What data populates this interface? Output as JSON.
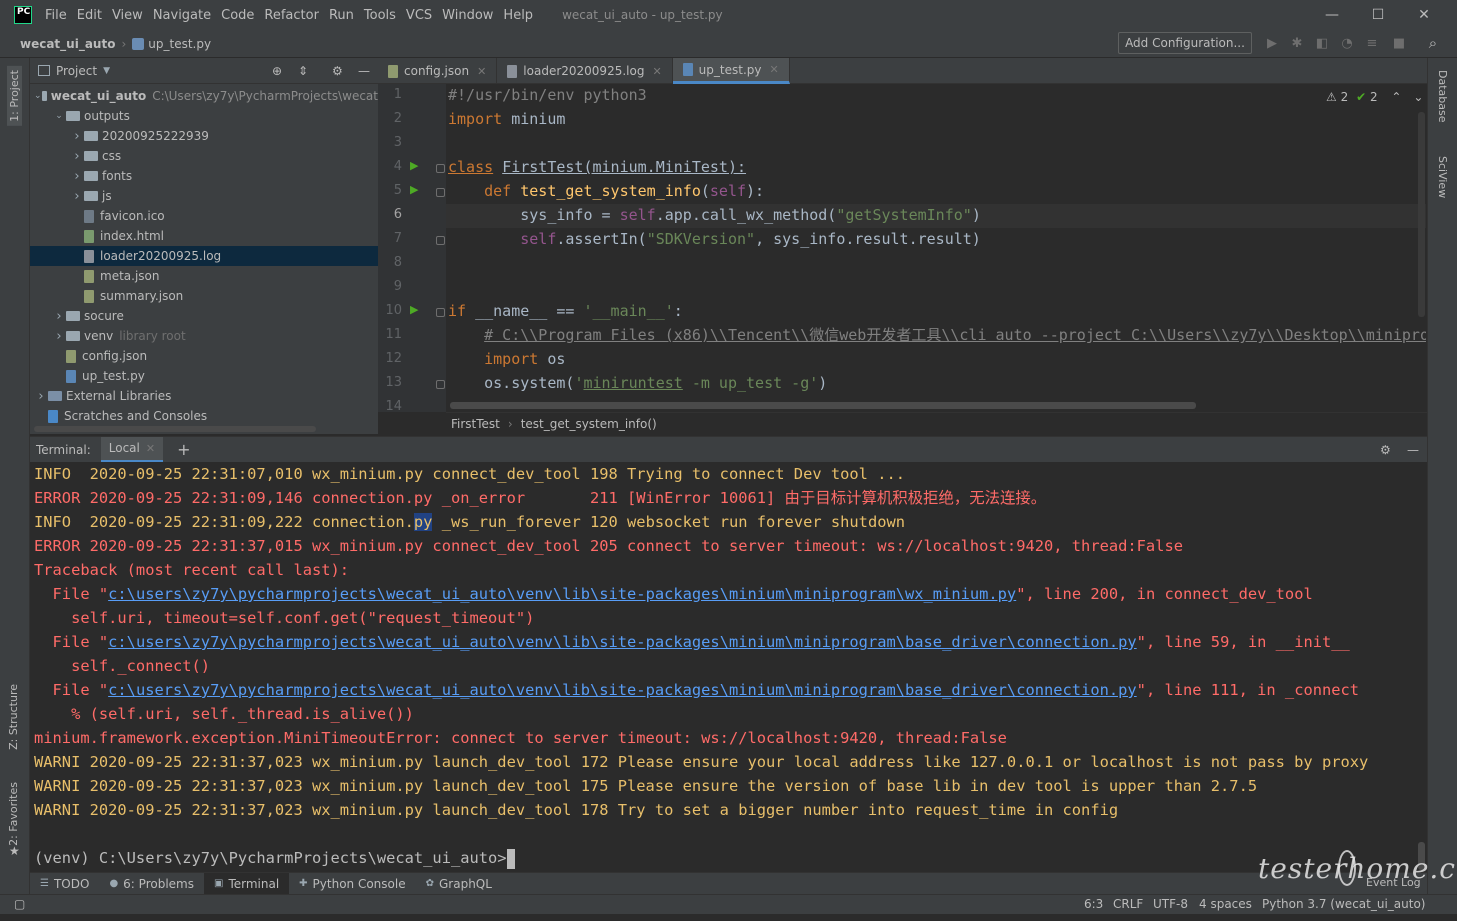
{
  "app": {
    "logo": "PC",
    "menu": [
      "File",
      "Edit",
      "View",
      "Navigate",
      "Code",
      "Refactor",
      "Run",
      "Tools",
      "VCS",
      "Window",
      "Help"
    ],
    "window_title": "wecat_ui_auto - up_test.py",
    "controls": {
      "minimize": "—",
      "maximize": "☐",
      "close": "✕"
    }
  },
  "navbar": {
    "project": "wecat_ui_auto",
    "file": "up_test.py",
    "add_configuration": "Add Configuration..."
  },
  "left_strip": {
    "project_tab": "1: Project",
    "structure_tab": "Z: Structure",
    "favorites_tab": "2: Favorites"
  },
  "right_strip": {
    "database_tab": "Database",
    "sciview_tab": "SciView"
  },
  "project_panel": {
    "title": "Project",
    "items": [
      {
        "name": "wecat_ui_auto",
        "path": "C:\\Users\\zy7y\\PycharmProjects\\wecat",
        "kind": "folder",
        "indent": 0,
        "expanded": true
      },
      {
        "name": "outputs",
        "kind": "folder",
        "indent": 1,
        "expanded": true
      },
      {
        "name": "20200925222939",
        "kind": "folder",
        "indent": 2,
        "expanded": false
      },
      {
        "name": "css",
        "kind": "folder",
        "indent": 2,
        "expanded": false
      },
      {
        "name": "fonts",
        "kind": "folder",
        "indent": 2,
        "expanded": false
      },
      {
        "name": "js",
        "kind": "folder",
        "indent": 2,
        "expanded": false
      },
      {
        "name": "favicon.ico",
        "kind": "file",
        "indent": 2
      },
      {
        "name": "index.html",
        "kind": "html",
        "indent": 2
      },
      {
        "name": "loader20200925.log",
        "kind": "log",
        "indent": 2,
        "selected": true
      },
      {
        "name": "meta.json",
        "kind": "json",
        "indent": 2
      },
      {
        "name": "summary.json",
        "kind": "json",
        "indent": 2
      },
      {
        "name": "socure",
        "kind": "folder",
        "indent": 1,
        "expanded": false
      },
      {
        "name": "venv",
        "note": "library root",
        "kind": "folder",
        "indent": 1,
        "expanded": false
      },
      {
        "name": "config.json",
        "kind": "json",
        "indent": 1
      },
      {
        "name": "up_test.py",
        "kind": "py",
        "indent": 1
      },
      {
        "name": "External Libraries",
        "kind": "lib",
        "indent": 0,
        "expanded": false
      },
      {
        "name": "Scratches and Consoles",
        "kind": "scratch",
        "indent": 0
      }
    ]
  },
  "editor": {
    "tabs": [
      {
        "label": "config.json",
        "active": false
      },
      {
        "label": "loader20200925.log",
        "active": false
      },
      {
        "label": "up_test.py",
        "active": true
      }
    ],
    "inspections": {
      "warnings": "2",
      "ok": "2"
    },
    "line_numbers": [
      "1",
      "2",
      "3",
      "4",
      "5",
      "6",
      "7",
      "8",
      "9",
      "10",
      "11",
      "12",
      "13",
      "14"
    ],
    "breadcrumb": [
      "FirstTest",
      "test_get_system_info()"
    ]
  },
  "terminal": {
    "label": "Terminal:",
    "tab": "Local",
    "prompt": "(venv) C:\\Users\\zy7y\\PycharmProjects\\wecat_ui_auto>"
  },
  "bottom_tabs": [
    {
      "label": "TODO",
      "icon": "list-icon"
    },
    {
      "label": "6: Problems",
      "icon": "problems-icon"
    },
    {
      "label": "Terminal",
      "icon": "terminal-icon",
      "active": true
    },
    {
      "label": "Python Console",
      "icon": "python-icon"
    },
    {
      "label": "GraphQL",
      "icon": "graphql-icon"
    }
  ],
  "status": {
    "position": "6:3",
    "line_sep": "CRLF",
    "encoding": "UTF-8",
    "indent": "4 spaces",
    "interpreter": "Python 3.7 (wecat_ui_auto)",
    "event_log": "Event Log"
  },
  "watermark": "testerhome.com"
}
